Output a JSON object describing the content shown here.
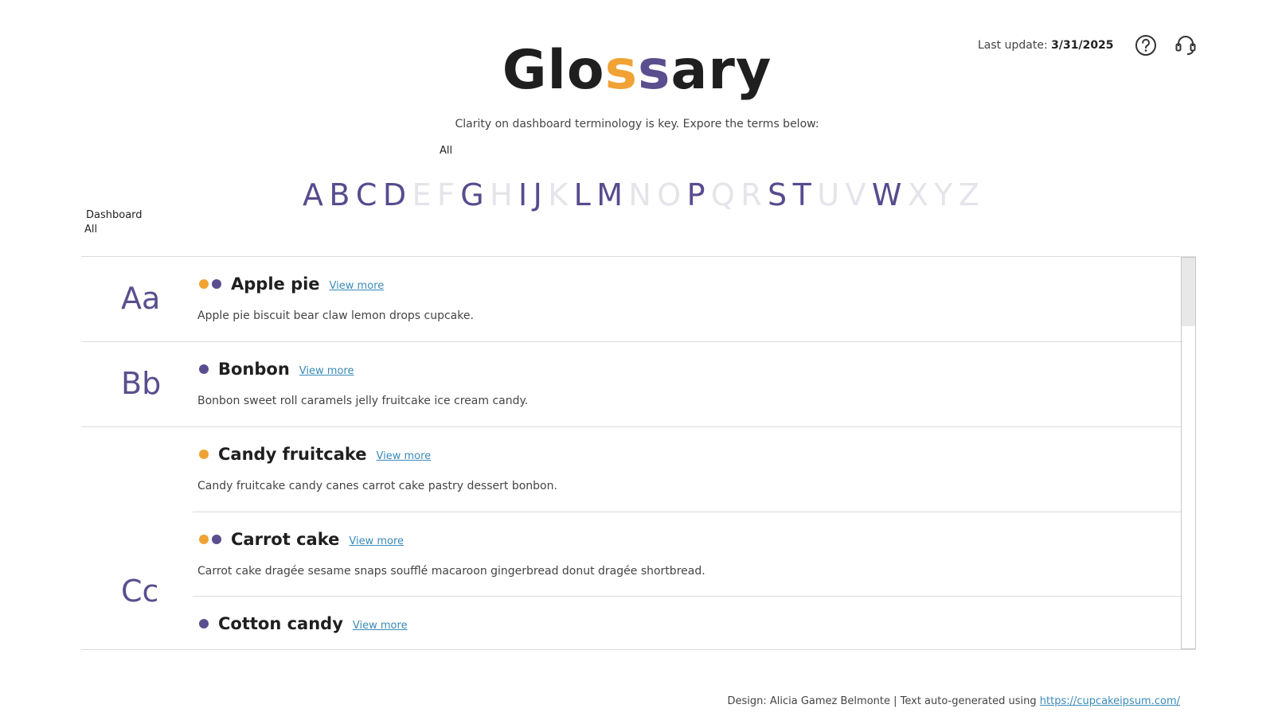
{
  "header": {
    "title_part1": "Glo",
    "title_o1": "s",
    "title_o2": "s",
    "title_part2": "ary",
    "subtitle": "Clarity on dashboard terminology is key. Expore the terms below:",
    "filter_all": "All",
    "last_update_label": "Last update:",
    "last_update_value": "3/31/2025",
    "help_icon": "help-circle-icon",
    "support_icon": "headset-icon"
  },
  "alphabet": [
    {
      "letter": "A",
      "active": true
    },
    {
      "letter": "B",
      "active": true
    },
    {
      "letter": "C",
      "active": true
    },
    {
      "letter": "D",
      "active": true
    },
    {
      "letter": "E",
      "active": false
    },
    {
      "letter": "F",
      "active": false
    },
    {
      "letter": "G",
      "active": true
    },
    {
      "letter": "H",
      "active": false
    },
    {
      "letter": "I",
      "active": true
    },
    {
      "letter": "J",
      "active": true
    },
    {
      "letter": "K",
      "active": false
    },
    {
      "letter": "L",
      "active": true
    },
    {
      "letter": "M",
      "active": true
    },
    {
      "letter": "N",
      "active": false
    },
    {
      "letter": "O",
      "active": false
    },
    {
      "letter": "P",
      "active": true
    },
    {
      "letter": "Q",
      "active": false
    },
    {
      "letter": "R",
      "active": false
    },
    {
      "letter": "S",
      "active": true
    },
    {
      "letter": "T",
      "active": true
    },
    {
      "letter": "U",
      "active": false
    },
    {
      "letter": "V",
      "active": false
    },
    {
      "letter": "W",
      "active": true
    },
    {
      "letter": "X",
      "active": false
    },
    {
      "letter": "Y",
      "active": false
    },
    {
      "letter": "Z",
      "active": false
    }
  ],
  "dashboard_filter": {
    "label": "Dashboard",
    "value": "All"
  },
  "groups": [
    {
      "letter": "Aa",
      "entries": [
        {
          "dots": [
            "orange",
            "purple"
          ],
          "term": "Apple pie",
          "link": "View more",
          "description": "Apple pie biscuit bear claw lemon drops cupcake."
        }
      ]
    },
    {
      "letter": "Bb",
      "entries": [
        {
          "dots": [
            "purple"
          ],
          "term": "Bonbon",
          "link": "View more",
          "description": "Bonbon sweet roll caramels jelly fruitcake ice cream candy."
        }
      ]
    },
    {
      "letter": "Cc",
      "entries": [
        {
          "dots": [
            "orange"
          ],
          "term": "Candy fruitcake",
          "link": "View more",
          "description": "Candy fruitcake candy canes carrot cake pastry dessert bonbon."
        },
        {
          "dots": [
            "orange",
            "purple"
          ],
          "term": "Carrot cake",
          "link": "View more",
          "description": "Carrot cake dragée sesame snaps soufflé macaroon gingerbread donut dragée shortbread."
        },
        {
          "dots": [
            "purple"
          ],
          "term": "Cotton candy",
          "link": "View more",
          "description": ""
        }
      ]
    }
  ],
  "colors": {
    "orange": "#f0a234",
    "purple": "#5a4e8e",
    "inactive_letter": "#e4e4ea",
    "link": "#3a8ab8"
  },
  "footer": {
    "text": "Design: Alicia Gamez Belmonte | Text auto-generated using ",
    "link": "https://cupcakeipsum.com/"
  }
}
